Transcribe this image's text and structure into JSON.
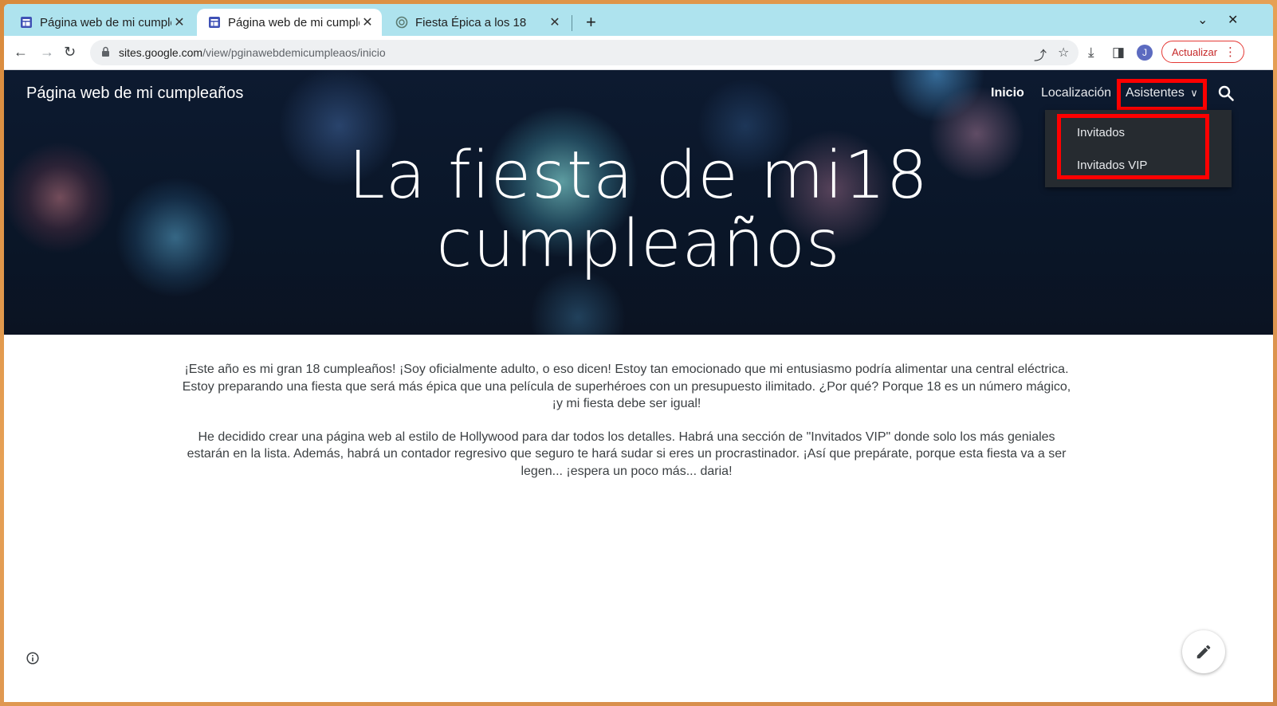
{
  "browser": {
    "tabs": [
      {
        "title": "Página web de mi cumpleaños",
        "active": false
      },
      {
        "title": "Página web de mi cumpleaños",
        "active": true
      },
      {
        "title": "Fiesta Épica a los 18",
        "active": false
      }
    ],
    "url_host": "sites.google.com",
    "url_path": "/view/pginawebdemicumpleaos/inicio",
    "profile_initial": "J",
    "update_label": "Actualizar"
  },
  "site": {
    "title": "Página web de mi cumpleaños",
    "nav": {
      "home": "Inicio",
      "location": "Localización",
      "attendees": "Asistentes"
    },
    "dropdown": [
      "Invitados",
      "Invitados VIP"
    ],
    "hero_title_line1": "La fiesta de mi18",
    "hero_title_line2": "cumpleaños",
    "paragraph1": "¡Este año es mi gran 18 cumpleaños! ¡Soy oficialmente adulto, o eso dicen! Estoy tan emocionado que mi entusiasmo podría alimentar una central eléctrica. Estoy preparando una fiesta que será más épica que una película de superhéroes con un presupuesto ilimitado. ¿Por qué? Porque 18 es un número mágico, ¡y mi fiesta debe ser igual!",
    "paragraph2": "He decidido crear una página web al estilo de Hollywood para dar todos los detalles. Habrá una sección de \"Invitados VIP\" donde solo los más geniales estarán en la lista. Además, habrá un contador regresivo que seguro te hará sudar si eres un procrastinador. ¡Así que prepárate, porque esta fiesta va a ser legen... ¡espera un poco más... daria!"
  },
  "colors": {
    "tabstrip": "#aee3ee",
    "highlight": "#ff0000",
    "dropdown_bg": "#262b30",
    "update_border": "#e53935"
  }
}
